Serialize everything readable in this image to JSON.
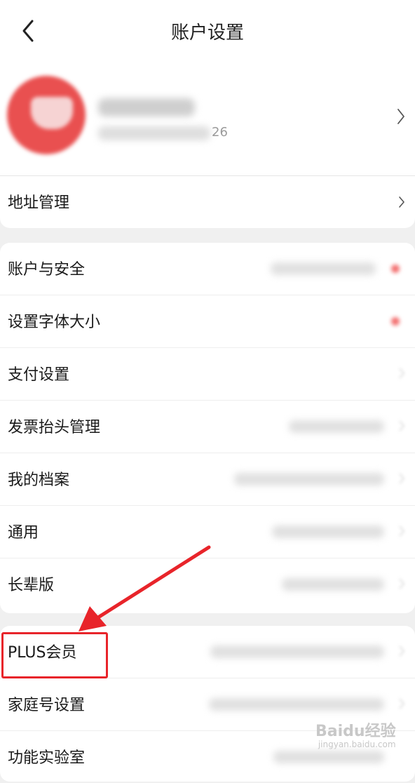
{
  "header": {
    "title": "账户设置",
    "back_icon": "chevron-left-icon"
  },
  "profile": {
    "sub_suffix": "26",
    "chevron_icon": "chevron-right-icon",
    "avatar_color": "#e95050"
  },
  "address": {
    "label": "地址管理"
  },
  "group1": [
    {
      "label": "账户与安全"
    },
    {
      "label": "设置字体大小"
    },
    {
      "label": "支付设置"
    },
    {
      "label": "发票抬头管理"
    },
    {
      "label": "我的档案"
    },
    {
      "label": "通用"
    },
    {
      "label": "长辈版"
    }
  ],
  "group2": [
    {
      "label": "PLUS会员"
    },
    {
      "label": "家庭号设置"
    },
    {
      "label": "功能实验室"
    }
  ],
  "annotation": {
    "color": "#e8242a"
  },
  "watermark": {
    "text": "Baidu经验",
    "sub": "jingyan.baidu.com"
  }
}
